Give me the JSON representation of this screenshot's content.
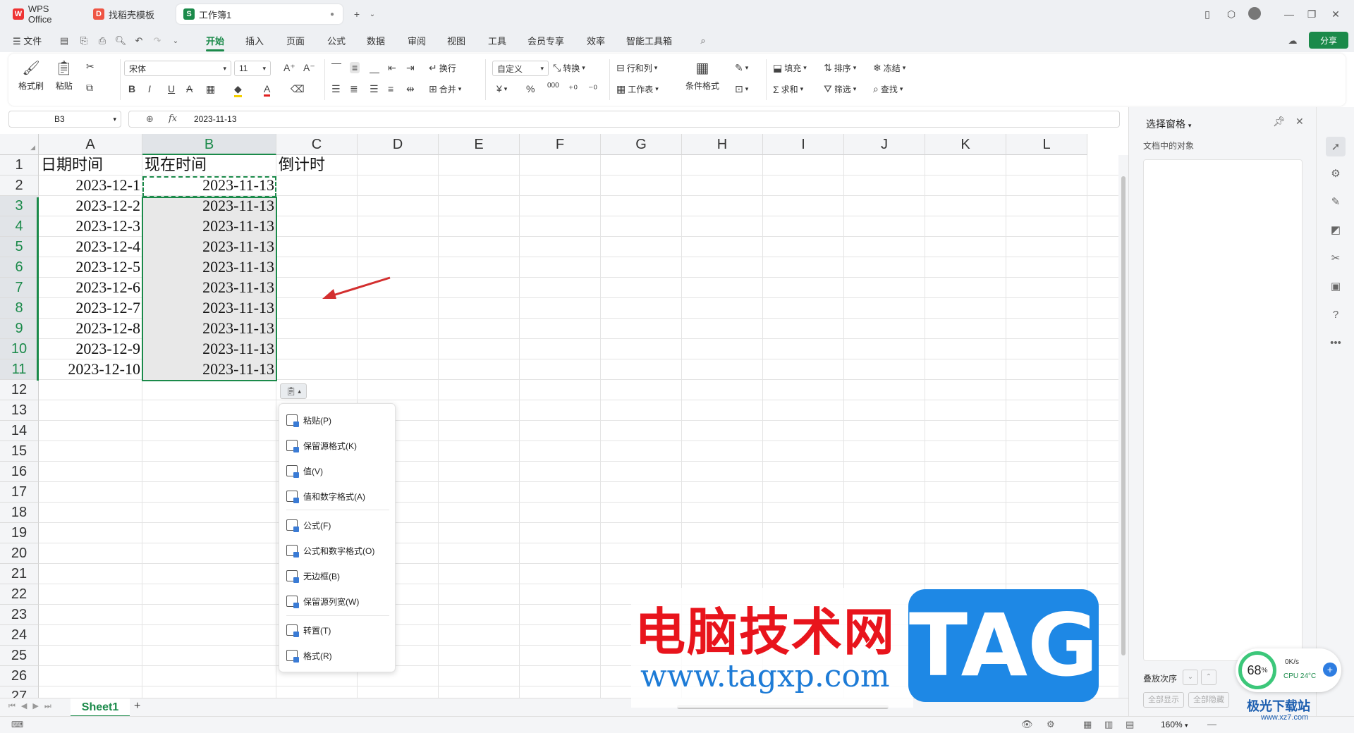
{
  "tabs": [
    {
      "label": "WPS Office",
      "icon": "wps-logo-icon"
    },
    {
      "label": "找稻壳模板",
      "icon": "docer-icon"
    },
    {
      "label": "工作簿1",
      "icon": "spreadsheet-icon"
    }
  ],
  "menu": {
    "file": "文件",
    "items": [
      "开始",
      "插入",
      "页面",
      "公式",
      "数据",
      "审阅",
      "视图",
      "工具",
      "会员专享",
      "效率",
      "智能工具箱"
    ],
    "active": "开始",
    "share": "分享"
  },
  "ribbon": {
    "format_painter": "格式刷",
    "paste": "粘贴",
    "font": "宋体",
    "size": "11",
    "wrap": "换行",
    "merge": "合并",
    "number_format": "自定义",
    "convert": "转换",
    "rows_cols": "行和列",
    "worksheet": "工作表",
    "cond_format": "条件格式",
    "fill": "填充",
    "sort": "排序",
    "freeze": "冻结",
    "sum": "求和",
    "filter": "筛选",
    "find": "查找",
    "currency": "¥",
    "percent": "%",
    "thousands": "000"
  },
  "formula_bar": {
    "cell_ref": "B3",
    "fx": "fx",
    "value": "2023-11-13"
  },
  "columns": [
    "A",
    "B",
    "C",
    "D",
    "E",
    "F",
    "G",
    "H",
    "I",
    "J",
    "K",
    "L"
  ],
  "rows": [
    "1",
    "2",
    "3",
    "4",
    "5",
    "6",
    "7",
    "8",
    "9",
    "10",
    "11",
    "12",
    "13",
    "14",
    "15",
    "16",
    "17",
    "18",
    "19",
    "20",
    "21",
    "22",
    "23",
    "24",
    "25",
    "26",
    "27"
  ],
  "cells": {
    "header": [
      "日期时间",
      "现在时间",
      "倒计时"
    ],
    "col_a": [
      "2023-12-1",
      "2023-12-2",
      "2023-12-3",
      "2023-12-4",
      "2023-12-5",
      "2023-12-6",
      "2023-12-7",
      "2023-12-8",
      "2023-12-9",
      "2023-12-10"
    ],
    "col_b": [
      "2023-11-13",
      "2023-11-13",
      "2023-11-13",
      "2023-11-13",
      "2023-11-13",
      "2023-11-13",
      "2023-11-13",
      "2023-11-13",
      "2023-11-13",
      "2023-11-13"
    ]
  },
  "paste_menu": {
    "items": [
      "粘贴(P)",
      "保留源格式(K)",
      "值(V)",
      "值和数字格式(A)",
      "公式(F)",
      "公式和数字格式(O)",
      "无边框(B)",
      "保留源列宽(W)",
      "转置(T)",
      "格式(R)"
    ]
  },
  "right_panel": {
    "title": "选择窗格",
    "subtitle": "文档中的对象",
    "order": "叠放次序",
    "show_all": "全部显示",
    "hide_all": "全部隐藏"
  },
  "sheet": {
    "name": "Sheet1"
  },
  "status": {
    "zoom": "160%",
    "cpu_pct": "68",
    "cpu_pct_unit": "%",
    "speed": "0K/s",
    "cpu_label": "CPU 24°C"
  },
  "watermark": {
    "cn": "电脑技术网",
    "url": "www.tagxp.com",
    "tag": "TAG",
    "corner": "极光下载站",
    "corner_url": "www.xz7.com"
  },
  "colors": {
    "accent": "#1b8a4a",
    "selection": "#e8e8e8",
    "arrow": "#d32f2f"
  }
}
